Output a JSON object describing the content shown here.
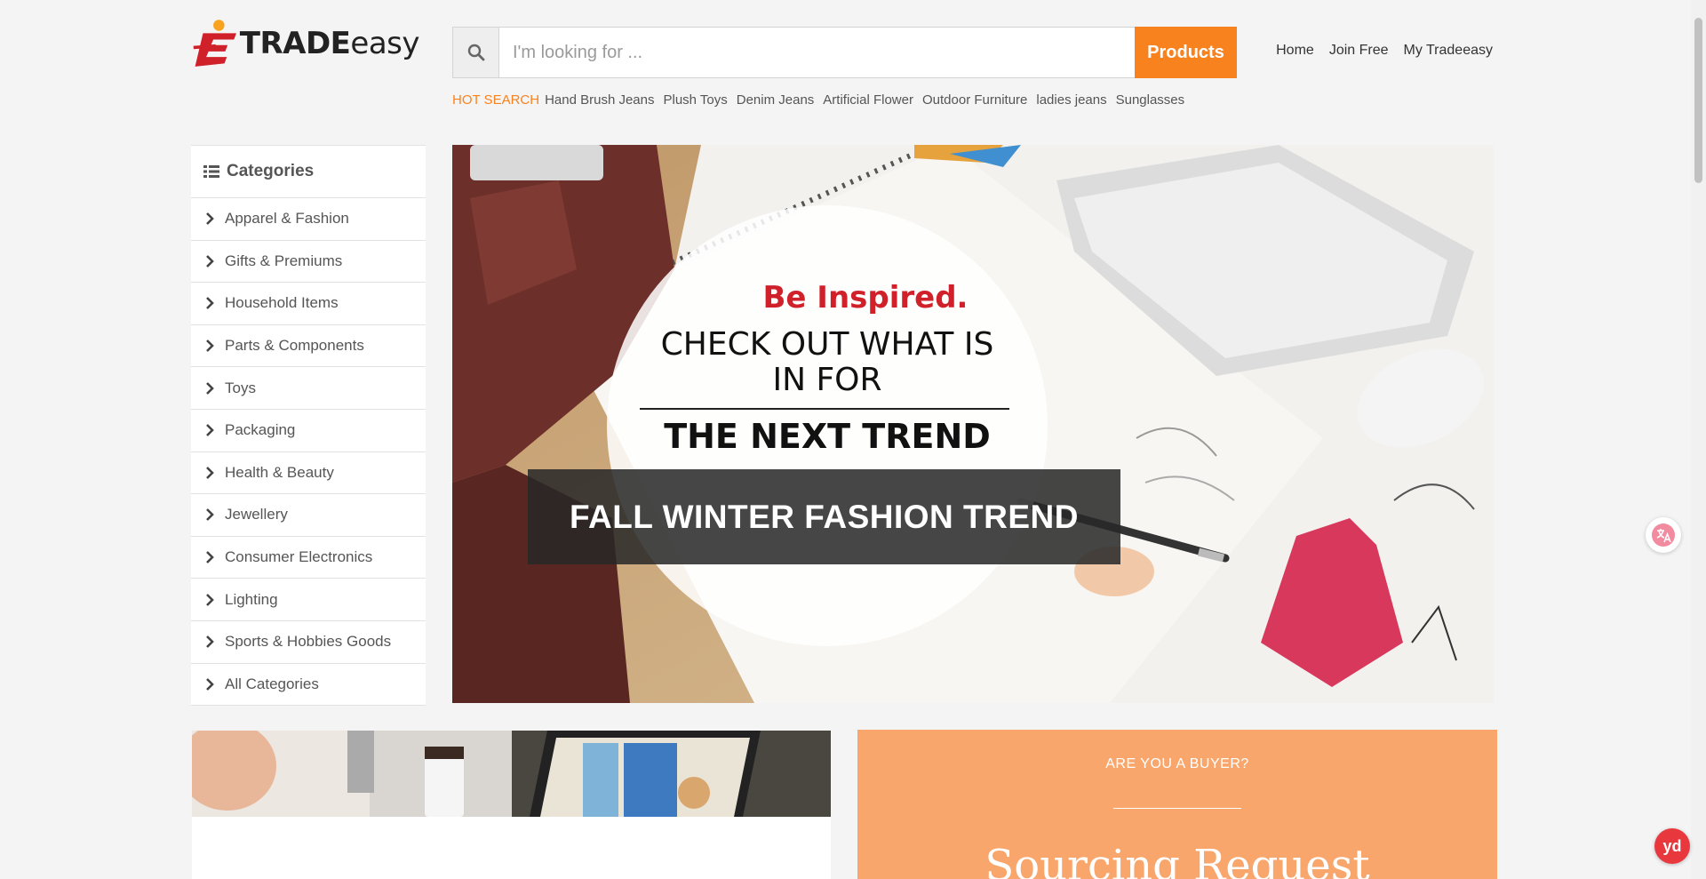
{
  "brand": {
    "logo_trade": "TRADE",
    "logo_easy": "easy"
  },
  "search": {
    "placeholder": "I'm looking for ...",
    "value": "",
    "button_label": "Products"
  },
  "top_nav": {
    "home": "Home",
    "join_free": "Join Free",
    "my_account": "My Tradeeasy"
  },
  "hot_search": {
    "label": "HOT SEARCH",
    "items": [
      "Hand Brush Jeans",
      "Plush Toys",
      "Denim Jeans",
      "Artificial Flower",
      "Outdoor Furniture",
      "ladies jeans",
      "Sunglasses"
    ]
  },
  "categories": {
    "title": "Categories",
    "items": [
      "Apparel & Fashion",
      "Gifts & Premiums",
      "Household Items",
      "Parts & Components",
      "Toys",
      "Packaging",
      "Health & Beauty",
      "Jewellery",
      "Consumer Electronics",
      "Lighting",
      "Sports & Hobbies Goods",
      "All Categories"
    ]
  },
  "hero": {
    "headline": "Be Inspired.",
    "line1": "CHECK OUT WHAT IS",
    "line2": "IN FOR",
    "line3": "THE NEXT TREND",
    "band": "FALL WINTER FASHION TREND"
  },
  "buyer_card": {
    "question": "ARE YOU A BUYER?",
    "title": "Sourcing Request"
  },
  "floating": {
    "yd_label": "yd"
  },
  "colors": {
    "accent": "#f8821e",
    "buyer_card": "#f8a66c",
    "brand_red": "#d0202a",
    "page_bg": "#f4f4f4"
  },
  "icons": {
    "search": "search-icon",
    "categories": "list-icon",
    "category_item": "chevron-right-icon",
    "translate": "translate-icon"
  }
}
